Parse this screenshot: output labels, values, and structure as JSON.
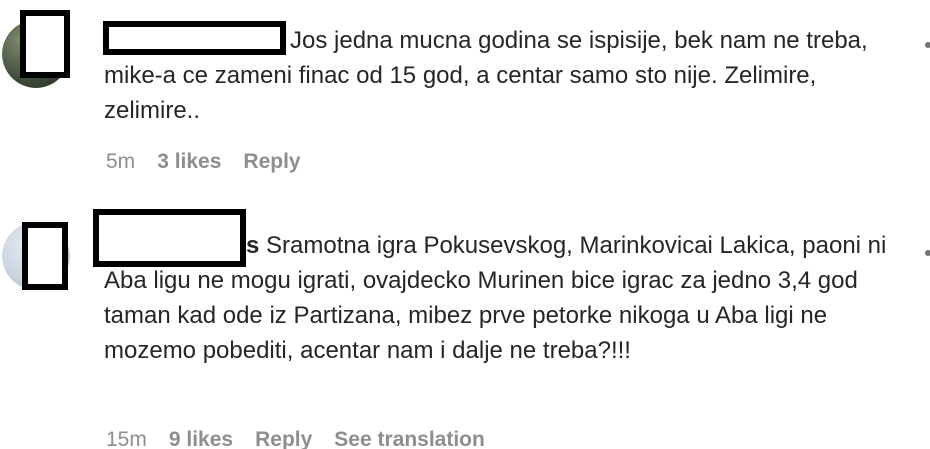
{
  "comments": [
    {
      "username": "",
      "text": "Jos jedna mucna godina se ispisije, bek nam ne treba, mike-a ce zameni finac od 15 god, a centar samo sto nije. Zelimire, zelimire..",
      "time": "5m",
      "likes": "3 likes",
      "reply_label": "Reply",
      "more_icon": "more-options-icon"
    },
    {
      "username": "s",
      "text": "Sramotna igra Pokusevskog, Marinkovicai Lakica, paoni ni Aba ligu ne mogu igrati, ovajdecko Murinen bice igrac za jedno 3,4 god taman kad ode iz Partizana, mibez prve petorke nikoga u Aba ligi ne mozemo pobediti, acentar nam i dalje ne treba?!!!",
      "time": "15m",
      "likes": "9 likes",
      "reply_label": "Reply",
      "translate_label": "See translation",
      "more_icon": "more-options-icon"
    }
  ],
  "colors": {
    "text": "#262626",
    "meta": "#8e8e8e",
    "redaction_border": "#000000",
    "avatar_1": "#3d4a3a",
    "avatar_2": "#c9d1e0"
  }
}
